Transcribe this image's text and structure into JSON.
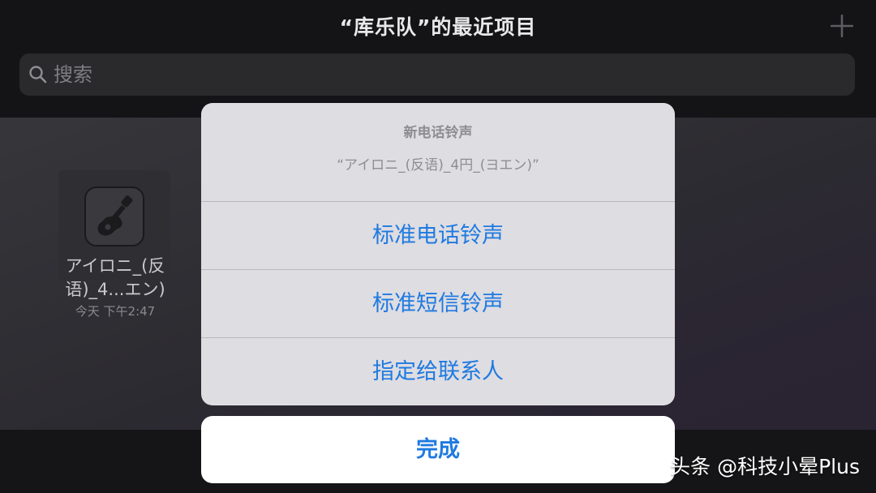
{
  "nav": {
    "title": "“库乐队”的最近项目"
  },
  "search": {
    "placeholder": "搜索"
  },
  "project": {
    "name_line1": "アイロニ_(反",
    "name_line2": "语)_4...エン)",
    "date": "今天 下午2:47"
  },
  "sheet": {
    "title": "新电话铃声",
    "message": "“アイロニ_(反语)_4円_(ヨエン)”",
    "actions": [
      {
        "label": "标准电话铃声"
      },
      {
        "label": "标准短信铃声"
      },
      {
        "label": "指定给联系人"
      }
    ],
    "done_label": "完成"
  },
  "watermark": {
    "text": "头条 @科技小晕Plus"
  },
  "colors": {
    "accent": "#1f7ae0",
    "sheet_bg": "#dedde2",
    "nav_bg": "#141416"
  },
  "icons": {
    "add": "plus-icon",
    "search": "magnifier-icon",
    "app": "garageband-guitar-icon"
  }
}
